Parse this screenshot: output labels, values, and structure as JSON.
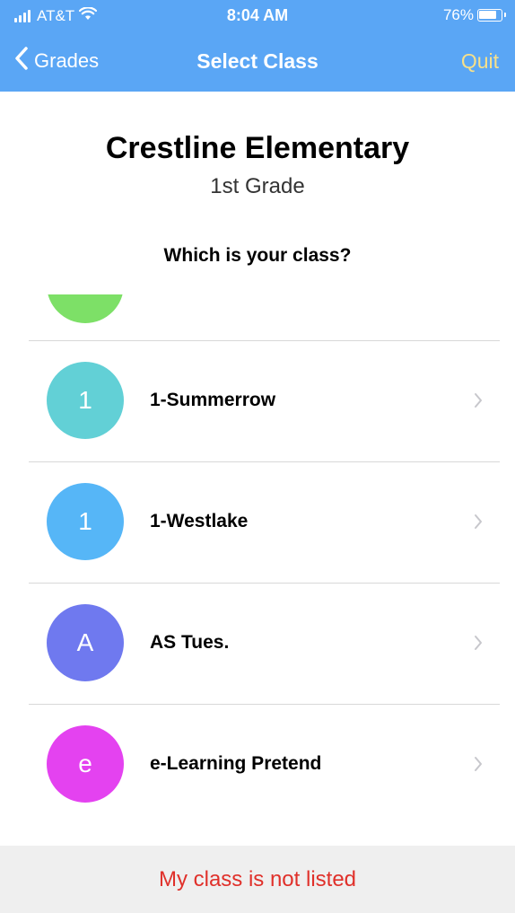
{
  "status_bar": {
    "carrier": "AT&T",
    "time": "8:04 AM",
    "battery": "76%"
  },
  "nav": {
    "back_label": "Grades",
    "title": "Select Class",
    "quit_label": "Quit"
  },
  "school": {
    "name": "Crestline Elementary",
    "grade": "1st Grade"
  },
  "prompt": "Which is your class?",
  "partial_item_color": "#7de067",
  "classes": [
    {
      "initial": "1",
      "name": "1-Summerrow",
      "color": "#62d0d6"
    },
    {
      "initial": "1",
      "name": "1-Westlake",
      "color": "#56b6f7"
    },
    {
      "initial": "A",
      "name": "AS Tues.",
      "color": "#6f79ef"
    },
    {
      "initial": "e",
      "name": "e-Learning Pretend",
      "color": "#e442f0"
    }
  ],
  "footer": {
    "label": "My class is not listed"
  },
  "colors": {
    "nav_background": "#5aa6f5",
    "quit": "#f7e08a",
    "footer_text": "#e0302a"
  }
}
